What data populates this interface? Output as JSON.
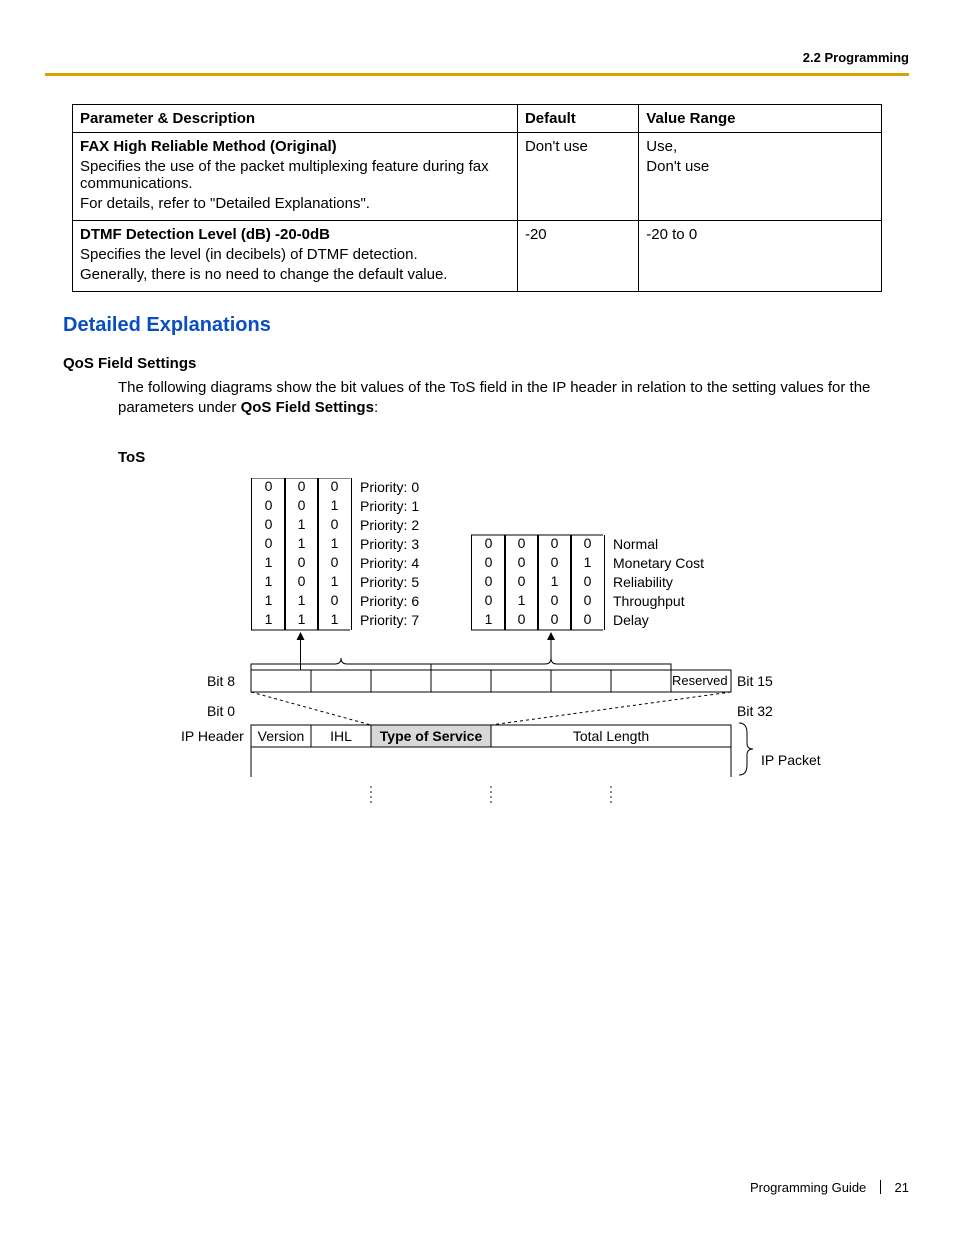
{
  "header": {
    "breadcrumb": "2.2 Programming"
  },
  "table": {
    "headers": {
      "param": "Parameter & Description",
      "def": "Default",
      "range": "Value Range"
    },
    "rows": [
      {
        "title": "FAX High Reliable Method (Original)",
        "line1": "Specifies the use of the packet multiplexing feature during fax communications.",
        "line2": "For details, refer to \"Detailed Explanations\".",
        "def": "Don't use",
        "range1": "Use,",
        "range2": "Don't use"
      },
      {
        "title": "DTMF Detection Level (dB) -20-0dB",
        "line1": "Specifies the level (in decibels) of DTMF detection.",
        "line2": "Generally, there is no need to change the default value.",
        "def": "-20",
        "range1": "-20 to 0",
        "range2": ""
      }
    ]
  },
  "section": {
    "title": "Detailed Explanations"
  },
  "qos": {
    "heading": "QoS Field Settings",
    "intro_a": "The following diagrams show the bit values of the ToS field in the IP header in relation to the setting values for the parameters under ",
    "intro_b": "QoS Field Settings",
    "intro_c": ":",
    "tos": "ToS"
  },
  "diagram": {
    "prio_rows": [
      {
        "bits": [
          "0",
          "0",
          "0"
        ],
        "label": "Priority: 0"
      },
      {
        "bits": [
          "0",
          "0",
          "1"
        ],
        "label": "Priority: 1"
      },
      {
        "bits": [
          "0",
          "1",
          "0"
        ],
        "label": "Priority: 2"
      },
      {
        "bits": [
          "0",
          "1",
          "1"
        ],
        "label": "Priority: 3"
      },
      {
        "bits": [
          "1",
          "0",
          "0"
        ],
        "label": "Priority: 4"
      },
      {
        "bits": [
          "1",
          "0",
          "1"
        ],
        "label": "Priority: 5"
      },
      {
        "bits": [
          "1",
          "1",
          "0"
        ],
        "label": "Priority: 6"
      },
      {
        "bits": [
          "1",
          "1",
          "1"
        ],
        "label": "Priority: 7"
      }
    ],
    "svc_rows": [
      {
        "bits": [
          "0",
          "0",
          "0",
          "0"
        ],
        "label": "Normal"
      },
      {
        "bits": [
          "0",
          "0",
          "0",
          "1"
        ],
        "label": "Monetary Cost"
      },
      {
        "bits": [
          "0",
          "0",
          "1",
          "0"
        ],
        "label": "Reliability"
      },
      {
        "bits": [
          "0",
          "1",
          "0",
          "0"
        ],
        "label": "Throughput"
      },
      {
        "bits": [
          "1",
          "0",
          "0",
          "0"
        ],
        "label": "Delay"
      }
    ],
    "labels": {
      "bit8": "Bit 8",
      "bit15": "Bit 15",
      "bit0": "Bit 0",
      "bit32": "Bit 32",
      "reserved": "Reserved",
      "ipheader": "IP Header",
      "version": "Version",
      "ihl": "IHL",
      "tos": "Type of Service",
      "tlen": "Total Length",
      "ippacket": "IP Packet"
    }
  },
  "footer": {
    "guide": "Programming Guide",
    "page": "21"
  }
}
